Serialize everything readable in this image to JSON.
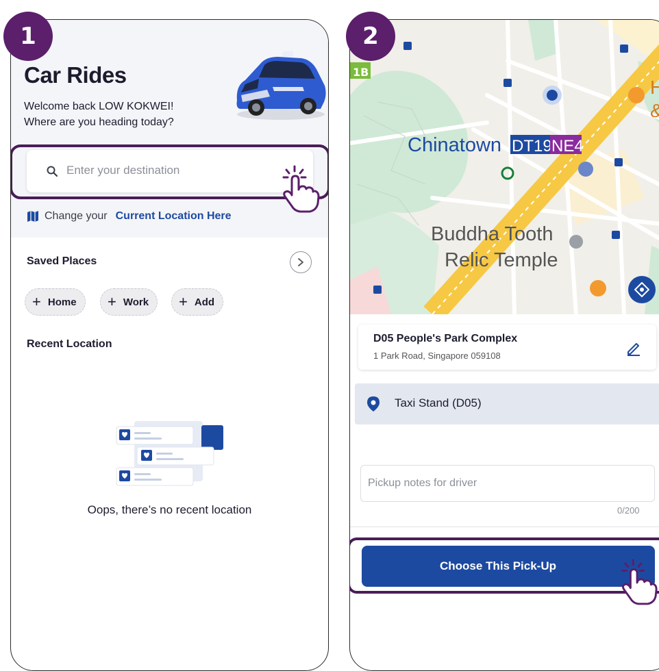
{
  "steps": [
    "1",
    "2"
  ],
  "screen1": {
    "title": "Car Rides",
    "welcome_line1": "Welcome back LOW KOKWEI!",
    "welcome_line2": "Where are you heading today?",
    "search": {
      "placeholder": "Enter your destination"
    },
    "location": {
      "prefix": "Change your",
      "link": "Current Location Here"
    },
    "saved_places": {
      "title": "Saved Places",
      "chips": [
        "Home",
        "Work",
        "Add"
      ]
    },
    "recent": {
      "title": "Recent Location",
      "empty_text": "Oops, there’s no recent location"
    }
  },
  "screen2": {
    "map": {
      "labels": {
        "chinatown": "Chinatown",
        "dt19": "DT19",
        "ne4": "NE4",
        "buddha1": "Buddha Tooth",
        "buddha2": "Relic Temple",
        "code_1b": "1B",
        "edge_h": "H",
        "edge_amp": "&"
      }
    },
    "address": {
      "name": "D05 People's Park Complex",
      "line": "1 Park Road, Singapore 059108"
    },
    "taxi_stand": "Taxi Stand (D05)",
    "notes": {
      "placeholder": "Pickup notes for driver",
      "counter": "0/200"
    },
    "cta_label": "Choose This Pick-Up"
  },
  "colors": {
    "primary_blue": "#1d4aa1",
    "step_purple": "#5b1f6b",
    "highlight_border": "#4a1d57",
    "map_green": "#cfe9d6",
    "mrt_line_yellow": "#f6c844"
  },
  "icons": [
    "search-icon",
    "map-icon",
    "chevron-right-icon",
    "plus-icon",
    "pencil-icon",
    "location-pin-icon",
    "tap-hand-icon",
    "recenter-icon",
    "taxi-car-illustration"
  ]
}
